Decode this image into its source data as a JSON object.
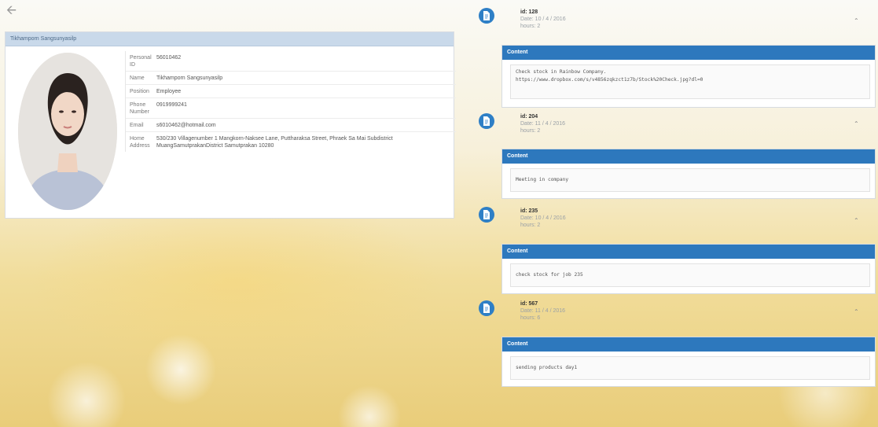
{
  "profile": {
    "header": "Tikhamporn Sangsunyasilp",
    "fields": [
      {
        "label": "Personal ID",
        "value": "56010462"
      },
      {
        "label": "Name",
        "value": "Tikhamporn  Sangsunyasilp"
      },
      {
        "label": "Position",
        "value": "Employee"
      },
      {
        "label": "Phone Number",
        "value": "0919999241"
      },
      {
        "label": "Email",
        "value": "s6010462@hotmail.com"
      },
      {
        "label": "Home Address",
        "value": "530/230 Villagenumber 1 Mangkorn-Naksee Lane,  Puttharaksa Street, Phraek Sa Mai Subdistrict  MuangSamutprakanDistrict  Samutprakan  10280"
      }
    ]
  },
  "entries": [
    {
      "id": "id: 128",
      "date": "Date: 10 / 4 / 2016",
      "hours": "hours: 2",
      "content_label": "Content",
      "content": "Check stock in Rainbow Company.\nhttps://www.dropbox.com/s/v4856zqkzct1z7b/Stock%20Check.jpg?dl=0"
    },
    {
      "id": "id: 204",
      "date": "Date: 11 / 4 / 2016",
      "hours": "hours: 2",
      "content_label": "Content",
      "content": "Meeting in company"
    },
    {
      "id": "id: 235",
      "date": "Date: 10 / 4 / 2016",
      "hours": "hours: 2",
      "content_label": "Content",
      "content": "check stock for job 235"
    },
    {
      "id": "id: 567",
      "date": "Date: 11 / 4 / 2016",
      "hours": "hours: 6",
      "content_label": "Content",
      "content": "sending products day1"
    }
  ],
  "icons": {
    "back": "arrow-left-icon",
    "entry_avatar": "document-icon",
    "toggle": "chevron-up-icon"
  },
  "colors": {
    "accent": "#2d78bd",
    "profile_header": "#c9d9ea"
  }
}
